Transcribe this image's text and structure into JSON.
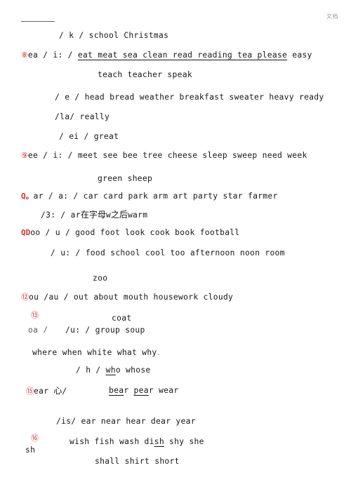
{
  "header": {
    "watermark": "文档",
    "rule": ""
  },
  "lines": [
    {
      "id": "line-k",
      "marker": "",
      "text": "/ k / school Christmas"
    },
    {
      "id": "line-8",
      "marker": "⑧",
      "pre": "ea / i: / ",
      "underlined": "eat meat sea clean read reading tea please",
      "post": " easy"
    },
    {
      "id": "line-8b",
      "marker": "",
      "text": "teach teacher speak"
    },
    {
      "id": "line-e",
      "marker": "",
      "text": "/ e / head bread weather breakfast sweater heavy ready"
    },
    {
      "id": "line-la",
      "marker": "",
      "text": "/la/ really"
    },
    {
      "id": "line-ei",
      "marker": "",
      "text": "/ ei / great"
    },
    {
      "id": "line-9",
      "marker": "⑨",
      "text": "ee / i: / meet see bee tree cheese sleep sweep need week"
    },
    {
      "id": "line-9b",
      "marker": "",
      "text": "green sheep"
    },
    {
      "id": "line-10",
      "marker": "Q。",
      "text": "ar / a: / car card park arm art party star farmer"
    },
    {
      "id": "line-10b",
      "marker": "",
      "pre": "/3: / ar",
      "cjk": "在字母",
      "mid": "w",
      "cjk2": "之后",
      "post": "warm"
    },
    {
      "id": "line-11",
      "marker": "QD",
      "text": "oo / u / good foot look cook book football"
    },
    {
      "id": "line-11b",
      "marker": "",
      "text": "/ u: / food school cool too afternoon noon room"
    },
    {
      "id": "line-11c",
      "marker": "",
      "text": "zoo"
    },
    {
      "id": "line-12",
      "marker": "⑫",
      "text": "ou /au / out about mouth housework cloudy"
    },
    {
      "id": "line-13",
      "marker": "⑬",
      "text": "coat"
    },
    {
      "id": "line-13b",
      "marker": "",
      "clipped": "oa /",
      "text": "/u: / group soup"
    },
    {
      "id": "line-14",
      "marker": "",
      "text": "where when white what why",
      "trailing": "."
    },
    {
      "id": "line-14b",
      "marker": "",
      "pre": "/ h / ",
      "underlined": "wh",
      "post": "o whose"
    },
    {
      "id": "line-15",
      "marker": "⑮",
      "pre": "ear ",
      "cjk": "心",
      "post": "/",
      "words": "bear pear wear"
    },
    {
      "id": "line-15b",
      "marker": "",
      "text": "/is/ ear near hear dear year"
    },
    {
      "id": "line-16",
      "marker": "⑯",
      "label": "sh",
      "text": "wish fish wash dish shy she"
    },
    {
      "id": "line-16b",
      "marker": "",
      "text": "shall shirt short"
    }
  ],
  "content": {
    "l_k": "/ k / school Christmas",
    "l8_num": "⑧",
    "l8_pre": "ea / i: / ",
    "l8_underlined": "eat meat sea clean read reading tea please",
    "l8_post": " easy",
    "l8b": "teach teacher speak",
    "l_e": "/ e / head bread weather breakfast sweater heavy ready",
    "l_la": "/la/ really",
    "l_ei": "/ ei / great",
    "l9_num": "⑨",
    "l9": "ee / i: / meet see bee tree cheese sleep sweep need week",
    "l9b": "green sheep",
    "l10_num": "Q。",
    "l10": "ar / a: / car card park arm art party star farmer",
    "l10b_pre": "/3: / ar",
    "l10b_cjk": "在字母",
    "l10b_mid": "w",
    "l10b_cjk2": "之后",
    "l10b_post": "warm",
    "l11_num": "QD",
    "l11": "oo / u / good foot look cook book football",
    "l11b": "/ u: / food school cool too afternoon noon room",
    "l11c": "zoo",
    "l12_num": "⑫",
    "l12": "ou /au / out about mouth housework cloudy",
    "l13_num": "⑬",
    "l13": "coat",
    "l13b_clip": "oa /",
    "l13b": "/u: / group soup",
    "l14": "where when white what why",
    "l14_dot": ".",
    "l14b_pre": "/ h / ",
    "l14b_u": "wh",
    "l14b_post": "o whose",
    "l15_num": "⑮",
    "l15_pre": "ear ",
    "l15_cjk": "心",
    "l15_slash": "/",
    "l15_b": "bea",
    "l15_br": "r ",
    "l15_p": "pea",
    "l15_pr": "r ",
    "l15_w": "wear",
    "l15b": "/is/ ear near hear dear year",
    "l16_num": "⑯",
    "l16_label": "sh",
    "l16_a": "wish fish wash di",
    "l16_u": "sh",
    "l16_b": " shy she",
    "l16b": "shall shirt short"
  }
}
